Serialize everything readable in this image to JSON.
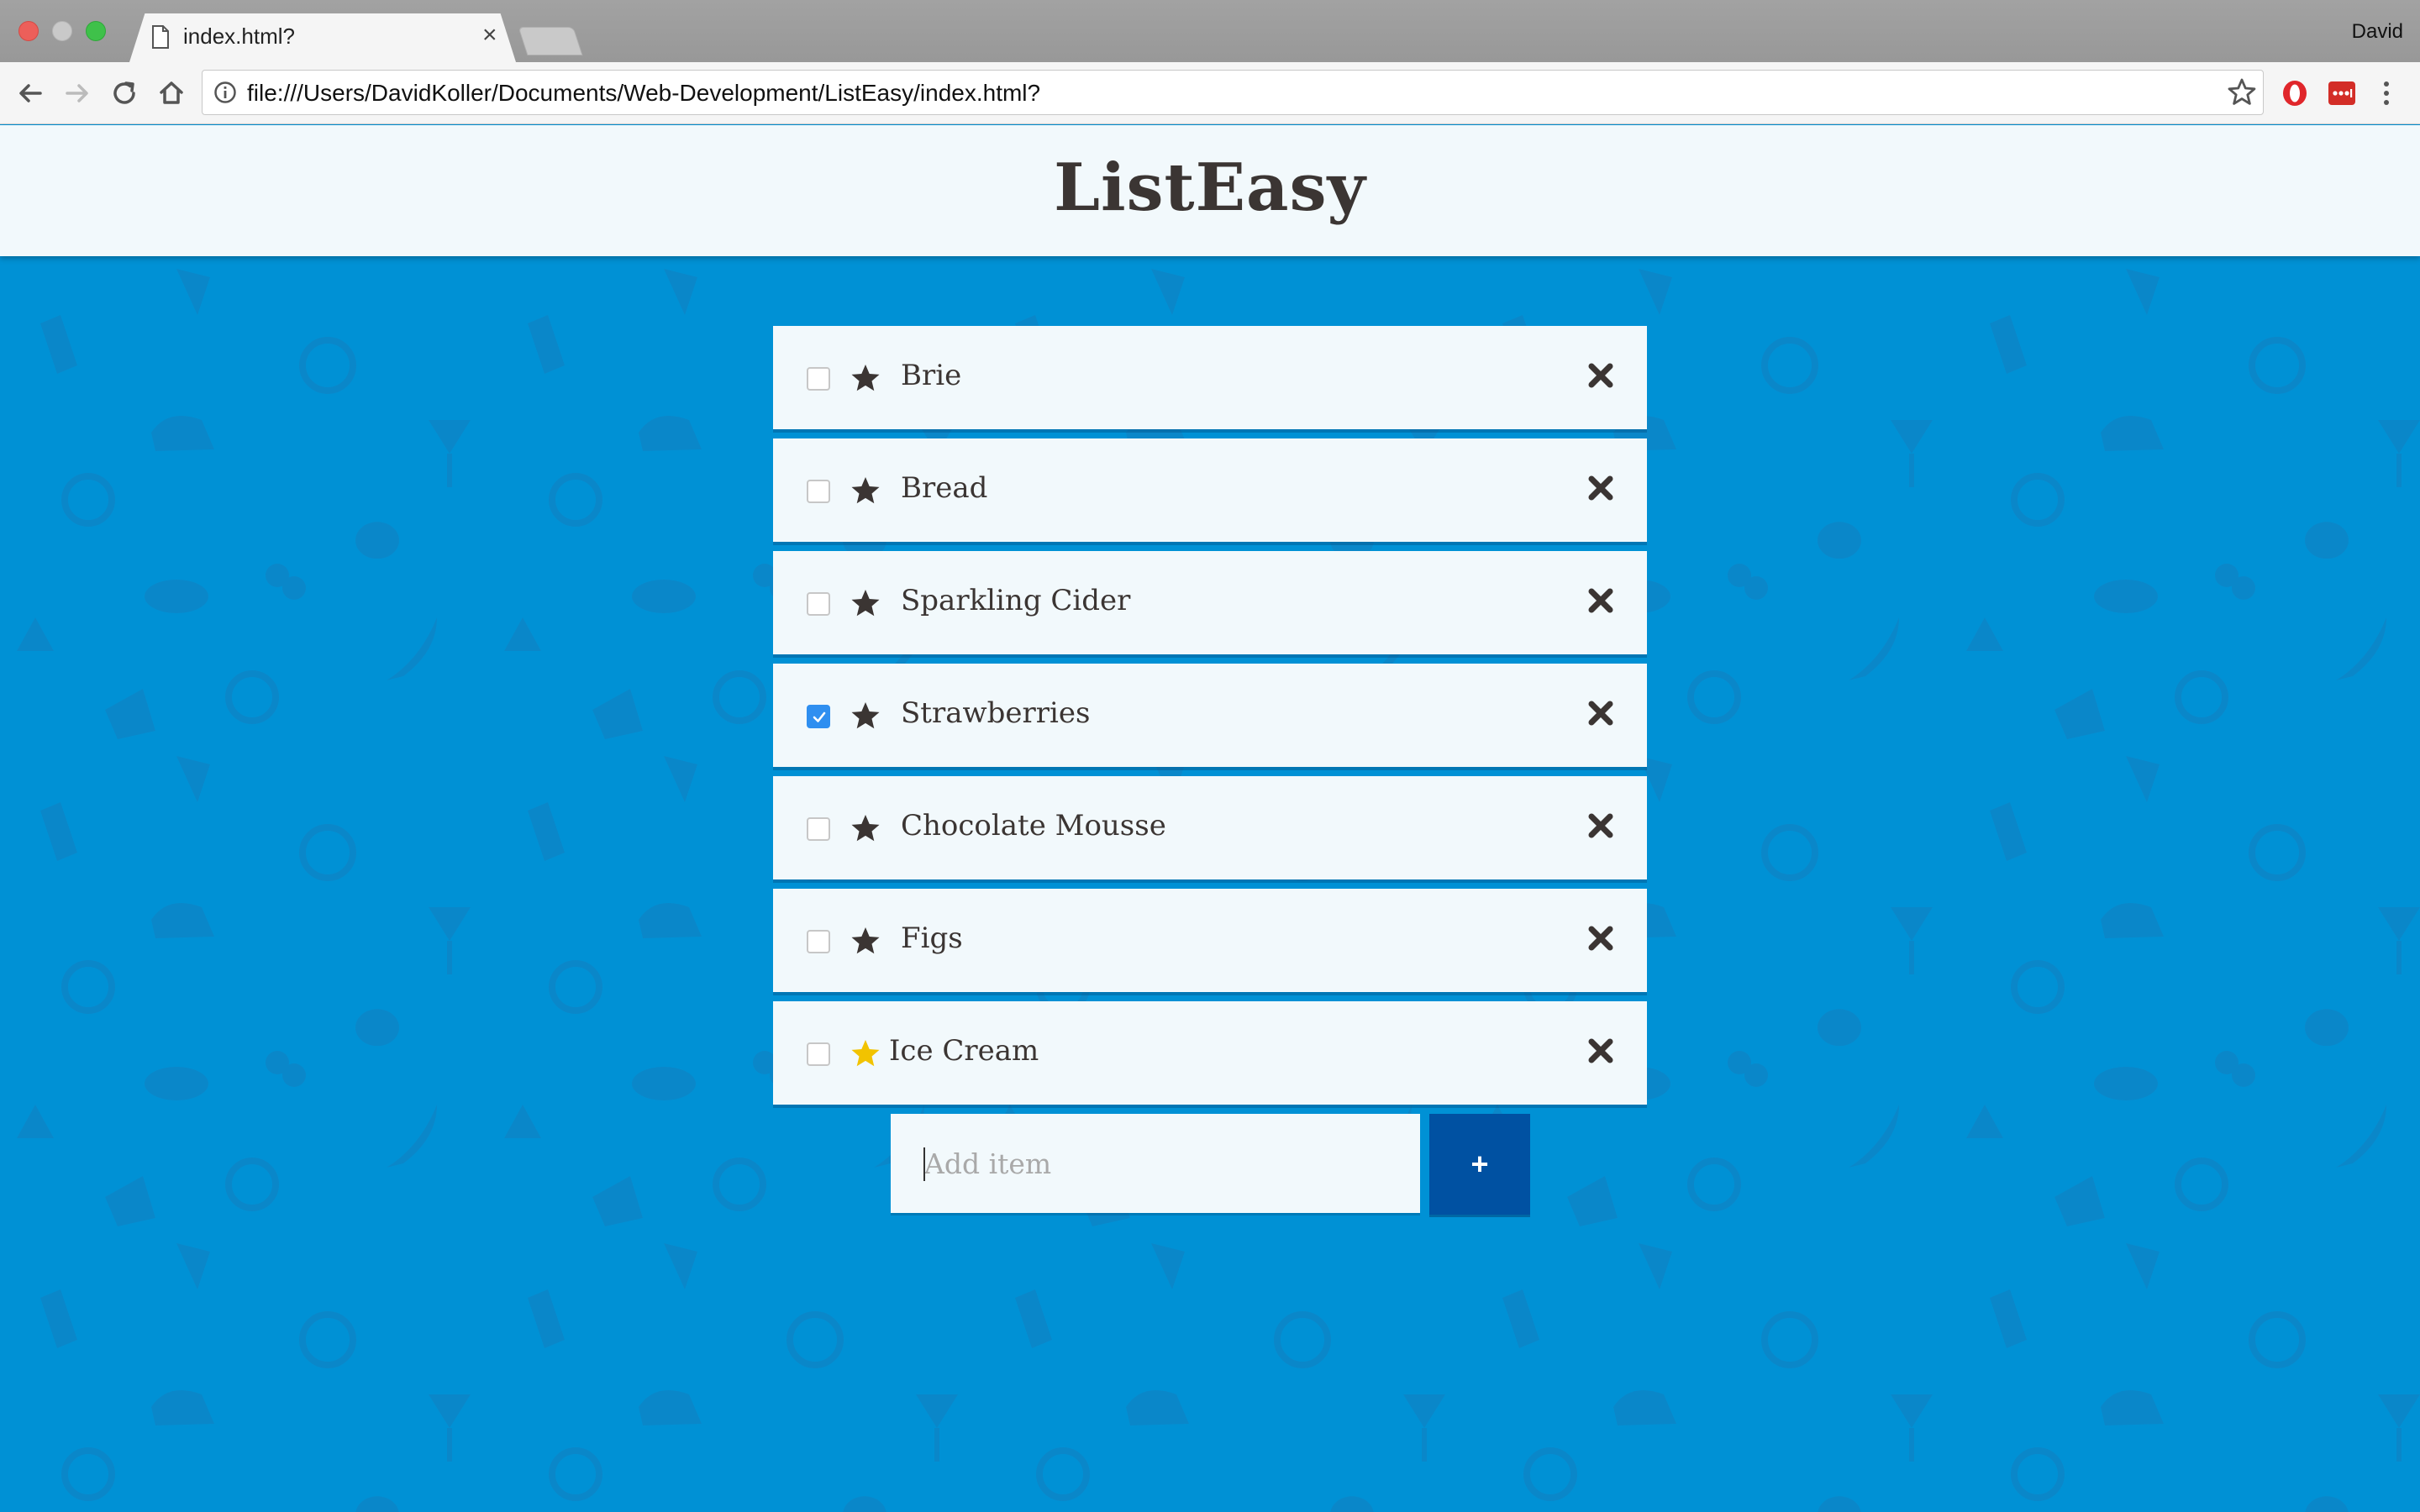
{
  "browser": {
    "tab_title": "index.html?",
    "tab_close": "×",
    "profile_name": "David",
    "url": "file:///Users/DavidKoller/Documents/Web-Development/ListEasy/index.html?"
  },
  "app": {
    "title": "ListEasy"
  },
  "items": [
    {
      "label": "Brie",
      "checked": false,
      "starred": false
    },
    {
      "label": "Bread",
      "checked": false,
      "starred": false
    },
    {
      "label": "Sparkling Cider",
      "checked": false,
      "starred": false
    },
    {
      "label": "Strawberries",
      "checked": true,
      "starred": false
    },
    {
      "label": "Chocolate Mousse",
      "checked": false,
      "starred": false
    },
    {
      "label": "Figs",
      "checked": false,
      "starred": false
    },
    {
      "label": "Ice Cream",
      "checked": false,
      "starred": true
    }
  ],
  "add_form": {
    "placeholder": "Add item",
    "button_label": "+"
  },
  "colors": {
    "background": "#0091d5",
    "card": "#f2f9fc",
    "text": "#3b3533",
    "star_active": "#f2c300",
    "checkbox_checked": "#2f8ff0",
    "add_button": "#0051a2"
  }
}
